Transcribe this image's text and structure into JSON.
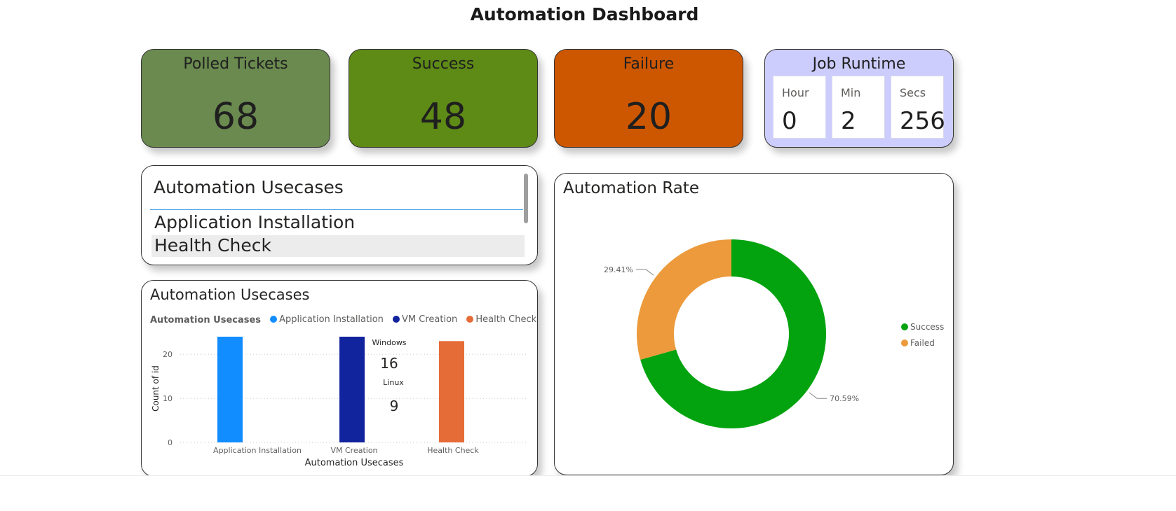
{
  "title": "Automation Dashboard",
  "kpis": {
    "polled": {
      "label": "Polled Tickets",
      "value": "68",
      "color": "#6a8a4f"
    },
    "success": {
      "label": "Success",
      "value": "48",
      "color": "#5e8a16"
    },
    "failure": {
      "label": "Failure",
      "value": "20",
      "color": "#cd5700"
    }
  },
  "runtime": {
    "title": "Job Runtime",
    "color": "#cccdfd",
    "hour": {
      "label": "Hour",
      "value": "0"
    },
    "min": {
      "label": "Min",
      "value": "2"
    },
    "secs": {
      "label": "Secs",
      "value": "256"
    }
  },
  "slicer": {
    "title": "Automation Usecases",
    "items": [
      {
        "label": "Application Installation"
      },
      {
        "label": "Health Check"
      }
    ]
  },
  "bar_panel": {
    "title": "Automation Usecases",
    "legend_title": "Automation Usecases",
    "annotations": {
      "windows_label": "Windows",
      "windows_value": "16",
      "linux_label": "Linux",
      "linux_value": "9"
    }
  },
  "donut_panel": {
    "title": "Automation Rate"
  },
  "chart_data": [
    {
      "type": "bar",
      "title": "Automation Usecases",
      "xlabel": "Automation Usecases",
      "ylabel": "Count of id",
      "categories": [
        "Application Installation",
        "VM Creation",
        "Health Check"
      ],
      "values": [
        24,
        24,
        23
      ],
      "colors": [
        "#118dff",
        "#12239e",
        "#e66c37"
      ],
      "ylim": [
        0,
        24
      ],
      "yticks": [
        0,
        10,
        20
      ],
      "grid": true,
      "legend": "top"
    },
    {
      "type": "pie",
      "title": "Automation Rate",
      "categories": [
        "Success",
        "Failed"
      ],
      "values": [
        70.59,
        29.41
      ],
      "labels": [
        "70.59%",
        "29.41%"
      ],
      "colors": [
        "#02a30f",
        "#ec9a3b"
      ],
      "legend": "right"
    }
  ]
}
